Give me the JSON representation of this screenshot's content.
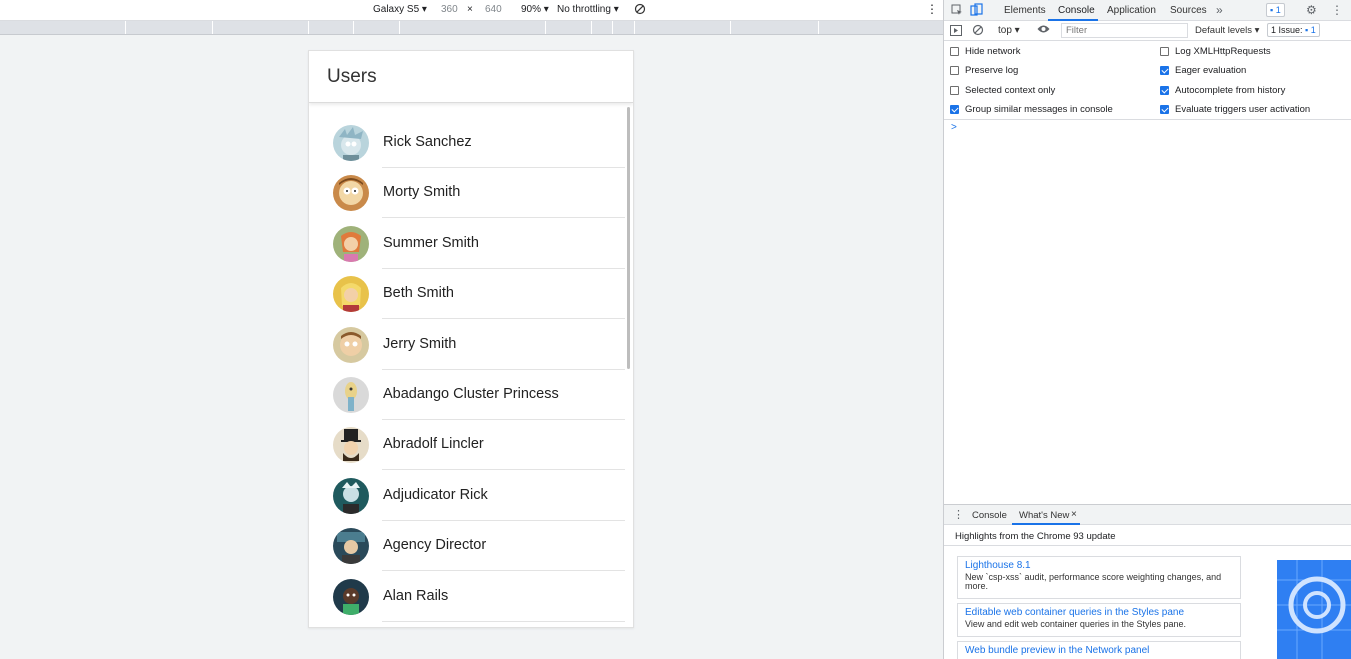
{
  "device_toolbar": {
    "device": "Galaxy S5",
    "width": "360",
    "times": "×",
    "height": "640",
    "zoom": "90%",
    "throttling": "No throttling"
  },
  "app": {
    "title": "Users",
    "users": [
      {
        "name": "Rick Sanchez"
      },
      {
        "name": "Morty Smith"
      },
      {
        "name": "Summer Smith"
      },
      {
        "name": "Beth Smith"
      },
      {
        "name": "Jerry Smith"
      },
      {
        "name": "Abadango Cluster Princess"
      },
      {
        "name": "Abradolf Lincler"
      },
      {
        "name": "Adjudicator Rick"
      },
      {
        "name": "Agency Director"
      },
      {
        "name": "Alan Rails"
      }
    ]
  },
  "devtools": {
    "tabs": [
      "Elements",
      "Console",
      "Application",
      "Sources"
    ],
    "active_tab": "Console",
    "more": "»",
    "issues_count": "1",
    "console_toolbar": {
      "context": "top",
      "filter_placeholder": "Filter",
      "levels": "Default levels",
      "issues_label": "1 Issue:",
      "issues_count": "1"
    },
    "settings": {
      "left": [
        {
          "label": "Hide network",
          "checked": false
        },
        {
          "label": "Preserve log",
          "checked": false
        },
        {
          "label": "Selected context only",
          "checked": false
        },
        {
          "label": "Group similar messages in console",
          "checked": true
        }
      ],
      "right": [
        {
          "label": "Log XMLHttpRequests",
          "checked": false
        },
        {
          "label": "Eager evaluation",
          "checked": true
        },
        {
          "label": "Autocomplete from history",
          "checked": true
        },
        {
          "label": "Evaluate triggers user activation",
          "checked": true
        }
      ]
    },
    "prompt": ">",
    "drawer": {
      "tabs": [
        "Console",
        "What's New"
      ],
      "active_tab": "What's New",
      "close": "×",
      "highlights": "Highlights from the Chrome 93 update",
      "cards": [
        {
          "title": "Lighthouse 8.1",
          "desc": "New `csp-xss` audit, performance score weighting changes, and more."
        },
        {
          "title": "Editable web container queries in the Styles pane",
          "desc": "View and edit web container queries in the Styles pane."
        },
        {
          "title": "Web bundle preview in the Network panel",
          "desc": ""
        }
      ]
    }
  },
  "colors": {
    "accent": "#1a73e8",
    "page_bg": "#f1f3f4"
  }
}
